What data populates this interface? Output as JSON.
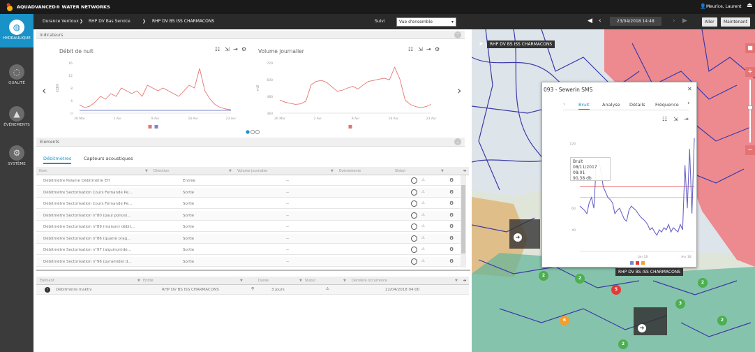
{
  "app": {
    "title": "AQUADVANCED® WATER NETWORKS",
    "user": "Meurice, Laurent"
  },
  "sidebar": {
    "items": [
      {
        "label": "HYDRAULIQUE",
        "icon": "globe-icon",
        "active": true
      },
      {
        "label": "QUALITÉ",
        "icon": "droplet-icon",
        "active": false
      },
      {
        "label": "ÉVÉNEMENTS",
        "icon": "bell-icon",
        "active": false
      },
      {
        "label": "SYSTÈME",
        "icon": "gear-icon",
        "active": false
      }
    ]
  },
  "breadcrumb": [
    "Durance Ventoux",
    "RHP DV Bas Service",
    "RHP DV BS ISS CHARMACONS"
  ],
  "nav": {
    "suivi_label": "Suivi",
    "view_select": "Vue d'ensemble",
    "date": "23/04/2018 14:48",
    "aller_label": "Aller",
    "maintenant_label": "Maintenant"
  },
  "indicateurs": {
    "section_title": "Indicateurs",
    "charts": [
      {
        "title": "Débit de nuit",
        "ylabel": "m3/h",
        "yticks": [
          "16",
          "12",
          "8",
          "4",
          "0"
        ],
        "xticks": [
          "26 Mar",
          "2 Avr",
          "9 Avr",
          "16 Avr",
          "23 Avr"
        ]
      },
      {
        "title": "Volume journalier",
        "ylabel": "m3",
        "yticks": [
          "720",
          "600",
          "480",
          "360"
        ],
        "xticks": [
          "26 Mar",
          "2 Avr",
          "9 Avr",
          "16 Avr",
          "23 Avr"
        ]
      }
    ]
  },
  "chart_data": [
    {
      "type": "line",
      "title": "Débit de nuit",
      "ylabel": "m3/h",
      "ylim": [
        0,
        18
      ],
      "x": [
        0,
        1,
        2,
        3,
        4,
        5,
        6,
        7,
        8,
        9,
        10,
        11,
        12,
        13,
        14,
        15,
        16,
        17,
        18,
        19,
        20,
        21,
        22,
        23,
        24,
        25,
        26,
        27,
        28,
        29
      ],
      "series": [
        {
          "color": "#e57373",
          "values": [
            3,
            2,
            2.5,
            4,
            6,
            5,
            7,
            6,
            9,
            8,
            7,
            8,
            6,
            10,
            9,
            8,
            9,
            8,
            7,
            6,
            8,
            10,
            9,
            16,
            8,
            5,
            3,
            2,
            1.5,
            1.2
          ]
        },
        {
          "color": "#7986cb",
          "values": [
            1,
            1,
            1,
            1,
            1,
            1,
            1,
            1,
            1,
            1,
            1,
            1,
            1,
            1,
            1,
            1,
            1,
            1,
            1,
            1,
            1,
            1,
            1,
            1,
            1,
            1,
            1,
            1,
            1,
            1
          ]
        }
      ]
    },
    {
      "type": "line",
      "title": "Volume journalier",
      "ylabel": "m3",
      "ylim": [
        300,
        760
      ],
      "x": [
        0,
        1,
        2,
        3,
        4,
        5,
        6,
        7,
        8,
        9,
        10,
        11,
        12,
        13,
        14,
        15,
        16,
        17,
        18,
        19,
        20,
        21,
        22,
        23,
        24,
        25,
        26,
        27,
        28,
        29
      ],
      "series": [
        {
          "color": "#e57373",
          "values": [
            420,
            400,
            390,
            380,
            385,
            410,
            560,
            590,
            600,
            580,
            540,
            500,
            510,
            530,
            545,
            520,
            560,
            590,
            600,
            610,
            620,
            605,
            720,
            610,
            420,
            380,
            360,
            350,
            360,
            380
          ]
        },
        {
          "color": "#7986cb",
          "values": []
        }
      ]
    },
    {
      "type": "line",
      "title": "093 - Sewerin SMS",
      "ylim": [
        20,
        130
      ],
      "yticks": [
        "120",
        "60",
        "40"
      ],
      "xticks": [
        "Jan 18",
        "Avr 18"
      ],
      "series": [
        {
          "name": "Bruit",
          "color": "#6a63c6",
          "values": [
            62,
            60,
            58,
            55,
            65,
            70,
            60,
            100,
            105,
            95,
            80,
            75,
            70,
            68,
            65,
            55,
            58,
            60,
            55,
            50,
            48,
            58,
            62,
            60,
            58,
            55,
            52,
            50,
            48,
            45,
            40,
            42,
            38,
            35,
            40,
            38,
            42,
            40,
            45,
            38,
            42,
            40,
            38,
            45,
            40,
            100,
            60,
            115,
            55,
            125
          ]
        }
      ],
      "hlines": [
        {
          "value": 80,
          "color": "#e53935"
        },
        {
          "value": 70,
          "color": "#f2b705"
        }
      ],
      "tooltip": {
        "label": "Bruit",
        "date": "08/11/2017 08:01",
        "value": "90,38 db"
      }
    }
  ],
  "elements": {
    "section_title": "Eléments",
    "tabs": [
      "Débitmètres",
      "Capteurs acoustiques"
    ],
    "columns": [
      "Nom",
      "Direction",
      "Volume journalier",
      "Evènements",
      "Statut"
    ],
    "rows": [
      {
        "name": "Débitmètre Palame Débitmètre EH",
        "direction": "Entrée",
        "volume": "--"
      },
      {
        "name": "Débitmètre Sectorisation Cours Fernande Pe...",
        "direction": "Sortie",
        "volume": "--"
      },
      {
        "name": "Débitmètre Sectorisation Cours Fernande Pe...",
        "direction": "Sortie",
        "volume": "--"
      },
      {
        "name": "Débitmètre Sectorisation n°80 (paul ponce)...",
        "direction": "Sortie",
        "volume": "--"
      },
      {
        "name": "Débitmètre Sectorisation n°89 (maison) débit...",
        "direction": "Sortie",
        "volume": "--"
      },
      {
        "name": "Débitmètre Sectorisation n°86 (quatre orag...",
        "direction": "Sortie",
        "volume": "--"
      },
      {
        "name": "Débitmètre Sectorisation n°97 (aiguinon)dé...",
        "direction": "Sortie",
        "volume": "--"
      },
      {
        "name": "Débitmètre Sectorisation n°96 (pyramide) d...",
        "direction": "Sortie",
        "volume": "--"
      }
    ]
  },
  "events": {
    "columns": [
      "Élément",
      "Entité",
      "Durée",
      "Statut",
      "Dernière occurrence"
    ],
    "rows": [
      {
        "name": "Débitmètre Inaktiv",
        "entity": "RHP DV BS ISS CHARMACONS",
        "duration": "3 jours",
        "last": "22/04/2018 04:00"
      }
    ]
  },
  "map": {
    "zone_label": "RHP DV BS ISS CHARMACONS",
    "zone_label_bottom": "RHP DV BS ISS CHARMACONS",
    "markers": [
      {
        "label": "2",
        "color": "#4caf50"
      },
      {
        "label": "2",
        "color": "#4caf50"
      },
      {
        "label": "5",
        "color": "#e53935"
      },
      {
        "label": "3",
        "color": "#4caf50"
      },
      {
        "label": "2",
        "color": "#4caf50"
      },
      {
        "label": "6",
        "color": "#f0a030"
      },
      {
        "label": "2",
        "color": "#4caf50"
      },
      {
        "label": "2",
        "color": "#4caf50"
      }
    ]
  },
  "popup": {
    "title": "093 - Sewerin SMS",
    "tabs": [
      "Bruit",
      "Analyse",
      "Détails",
      "Fréquence"
    ],
    "tooltip_label": "Bruit",
    "tooltip_date": "08/11/2017 08:01",
    "tooltip_value": "90,38 db"
  }
}
